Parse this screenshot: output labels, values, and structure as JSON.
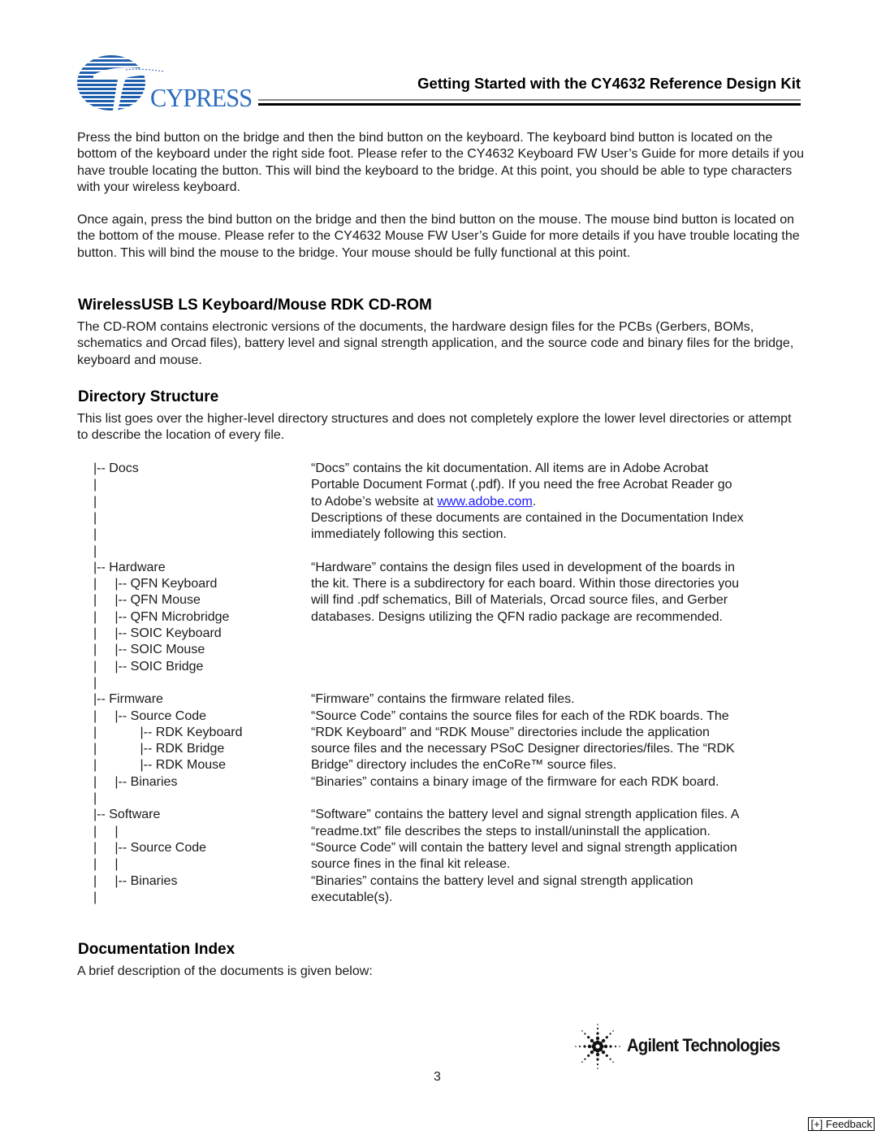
{
  "header": {
    "logo_text": "CYPRESS",
    "title": "Getting Started with the CY4632 Reference Design Kit",
    "brand_color": "#1f5fae"
  },
  "intro": {
    "paragraphs": [
      "Press the bind button on the bridge and then the bind button on the keyboard. The keyboard bind button is located on the bottom of the keyboard under the right side foot. Please refer to the CY4632 Keyboard FW User’s Guide for more details if you have trouble locating the button.  This will bind the keyboard to the bridge. At this point, you should be able to type characters with your wireless keyboard.",
      "Once again, press the bind button on the bridge and then the bind button on the mouse. The mouse bind button is located on the bottom of the mouse.  Please refer to the CY4632 Mouse FW User’s Guide for more details if you have trouble locating the button.  This will bind the mouse to the bridge. Your mouse should be fully functional at this point."
    ]
  },
  "cdrom": {
    "heading": "WirelessUSB LS Keyboard/Mouse RDK CD-ROM",
    "body": "The CD-ROM contains electronic versions of the documents, the hardware design files for the PCBs (Gerbers, BOMs, schematics and Orcad files), battery level and signal strength application, and the source code and binary files for the bridge, keyboard and mouse."
  },
  "directory": {
    "heading": "Directory Structure",
    "body": "This list goes over the higher-level directory structures and does not completely explore the lower level directories or attempt to describe the location of every file.",
    "tree": [
      "|-- Docs",
      "|",
      "|",
      "|",
      "|",
      "|",
      "|-- Hardware",
      "|     |-- QFN Keyboard",
      "|     |-- QFN Mouse",
      "|     |-- QFN Microbridge",
      "|     |-- SOIC Keyboard",
      "|     |-- SOIC Mouse",
      "|     |-- SOIC Bridge",
      "|",
      "|-- Firmware",
      "|     |-- Source Code",
      "|            |-- RDK Keyboard",
      "|            |-- RDK Bridge",
      "|            |-- RDK Mouse",
      "|     |-- Binaries",
      "|",
      "|-- Software",
      "|     |",
      "|     |-- Source Code",
      "|     |",
      "|     |-- Binaries",
      "|"
    ],
    "descriptions": [
      "“Docs” contains the kit documentation. All items are in Adobe Acrobat",
      "Portable Document Format (.pdf). If you need the free Acrobat Reader go",
      "",
      "Descriptions of these documents are contained in the Documentation Index",
      "immediately following this section.",
      "",
      "“Hardware” contains the design files used in development of the boards in",
      "the kit. There is a subdirectory for each board. Within those directories you",
      "will find .pdf schematics, Bill of Materials, Orcad source files, and Gerber",
      "databases.  Designs utilizing the QFN radio package are recommended.",
      "",
      "",
      "",
      "",
      "“Firmware” contains the firmware related files.",
      "“Source Code” contains the source files for each of the RDK boards.  The",
      "“RDK Keyboard” and “RDK Mouse” directories include the application",
      "source files and the necessary PSoC Designer directories/files. The “RDK",
      "Bridge” directory includes the enCoRe™ source files.",
      "“Binaries” contains a binary image of the firmware for each RDK board.",
      "",
      "“Software” contains the battery level and signal strength application files.  A",
      "“readme.txt” file describes the steps to install/uninstall the application.",
      "“Source Code” will contain the battery level and signal strength application",
      "source fines in the final kit release.",
      "“Binaries” contains the battery level and signal strength application",
      "executable(s)."
    ],
    "adobe_line_prefix": "to Adobe’s website at ",
    "adobe_link": "www.adobe.com",
    "adobe_line_suffix": "."
  },
  "doc_index": {
    "heading": "Documentation Index",
    "body": "A brief description of the documents is given below:"
  },
  "footer": {
    "partner_logo_text": "Agilent Technologies",
    "page_number": "3",
    "feedback_label": "[+] Feedback"
  }
}
